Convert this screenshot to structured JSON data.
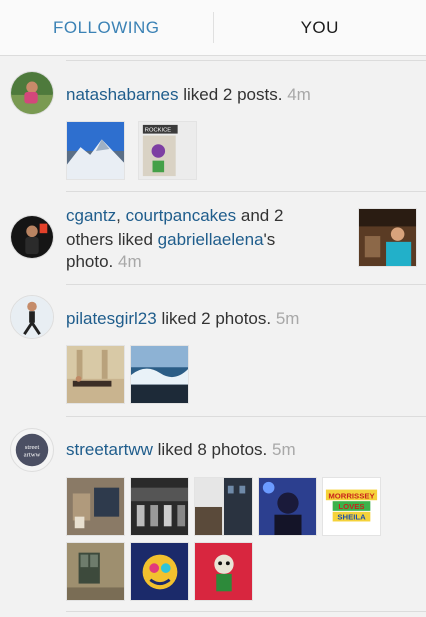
{
  "tabs": {
    "following": "FOLLOWING",
    "you": "YOU"
  },
  "items": [
    {
      "user": "natashabarnes",
      "action": "liked 2 posts.",
      "time": "4m",
      "photos": [
        "mountain-photo",
        "rockice-poster-photo"
      ]
    },
    {
      "user1": "cgantz",
      "comma": ",",
      "user2": "courtpancakes",
      "and": "and 2",
      "others": "others liked",
      "target": "gabriellaelena",
      "possessive": "'s",
      "photo_word": "photo.",
      "time": "4m",
      "photos": [
        "bar-scene-photo"
      ]
    },
    {
      "user": "pilatesgirl23",
      "action": "liked 2 photos.",
      "time": "5m",
      "photos": [
        "pilates-studio-photo",
        "ocean-wave-photo"
      ]
    },
    {
      "user": "streetartww",
      "avatar_text": "street artww",
      "action": "liked 8 photos.",
      "time": "5m",
      "photos": [
        "saint-street-sign-photo",
        "bw-street-photo",
        "city-building-photo",
        "portrait-blue-photo",
        "morrissey-loves-sheila-photo",
        "old-window-photo",
        "colorful-mural-photo",
        "red-graffiti-photo"
      ],
      "morrissey": {
        "line1": "MORRISSEY",
        "line2": "LOVES",
        "line3": "SHEILA"
      },
      "rockice": "ROCKICE"
    }
  ]
}
